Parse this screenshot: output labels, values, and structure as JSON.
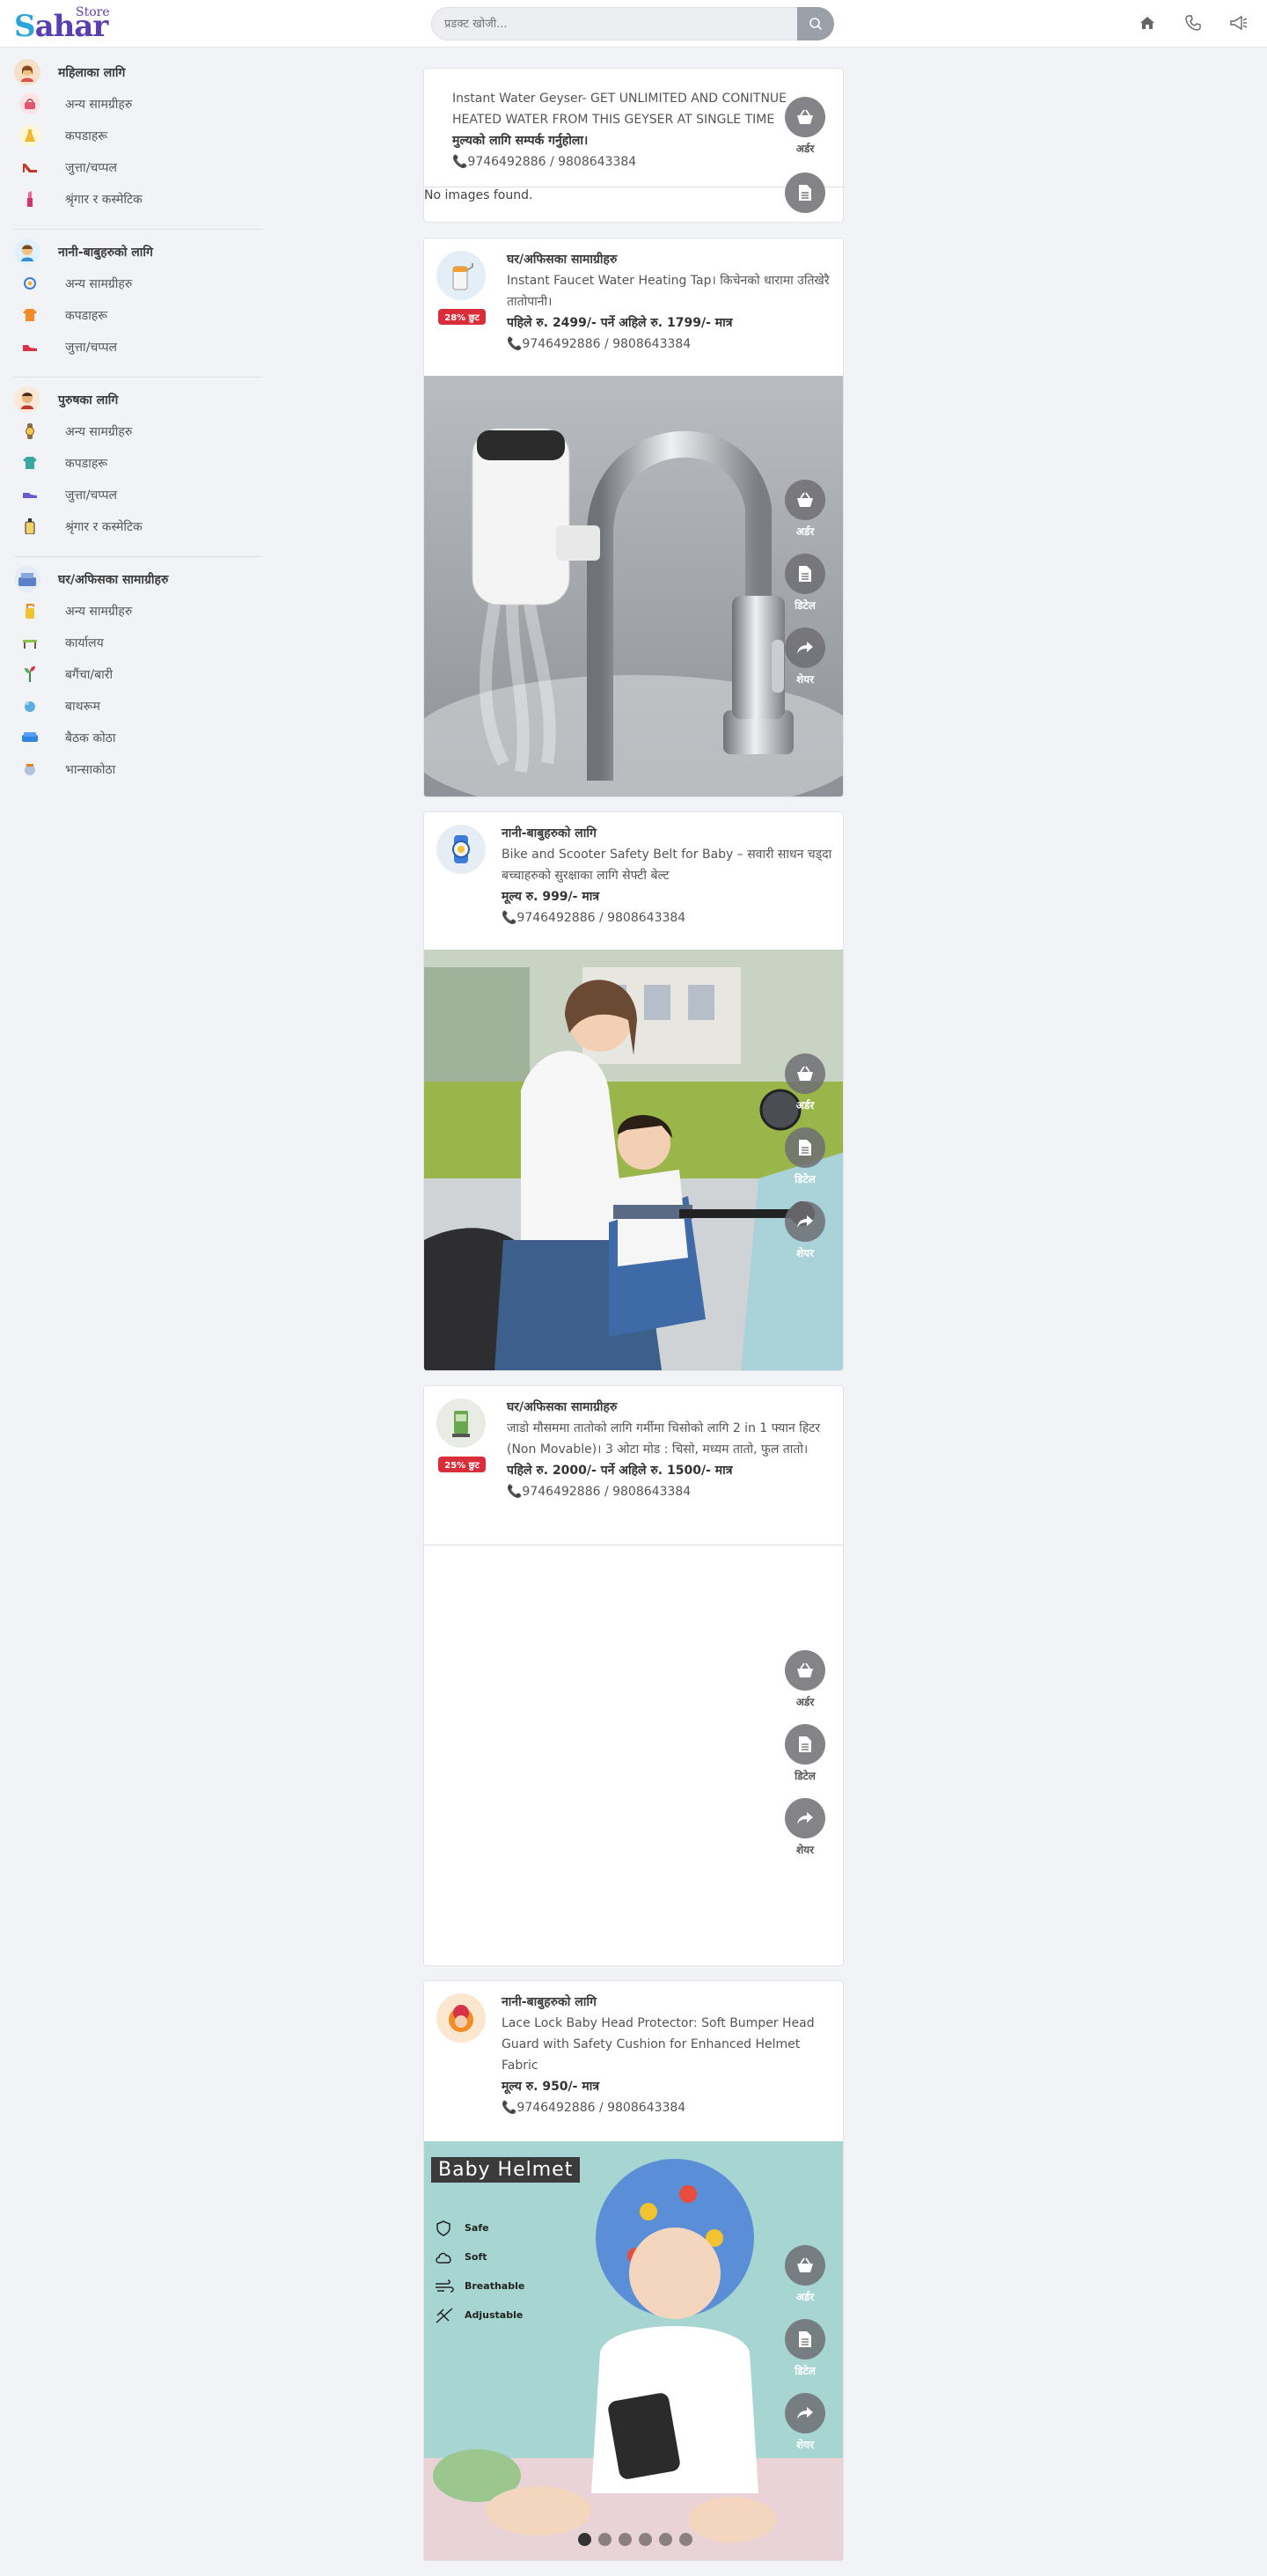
{
  "header": {
    "logo_main": "Sahar",
    "logo_small": "Store",
    "search_placeholder": "प्रडक्ट खोजी..."
  },
  "sidebar": [
    {
      "title": "महिलाका लागि",
      "items": [
        "अन्य सामग्रीहरु",
        "कपडाहरू",
        "जुत्ता/चप्पल",
        "श्रृंगार र कस्मेटिक"
      ]
    },
    {
      "title": "नानी-बाबुहरुको लागि",
      "items": [
        "अन्य सामग्रीहरु",
        "कपडाहरू",
        "जुत्ता/चप्पल"
      ]
    },
    {
      "title": "पुरुषका लागि",
      "items": [
        "अन्य सामग्रीहरु",
        "कपडाहरू",
        "जुत्ता/चप्पल",
        "श्रृंगार र कस्मेटिक"
      ]
    },
    {
      "title": "घर/अफिसका सामाग्रीहरु",
      "items": [
        "अन्य सामग्रीहरु",
        "कार्यालय",
        "बगैंचा/बारी",
        "बाथरूम",
        "बैठक कोठा",
        "भान्साकोठा"
      ]
    }
  ],
  "actions": {
    "order": "अर्डर",
    "detail": "डिटेल",
    "share": "शेयर"
  },
  "posts": [
    {
      "description": "Instant Water Geyser- GET UNLIMITED AND CONITNUE HEATED WATER FROM THIS GEYSER AT SINGLE TIME",
      "price_line": "मुल्यको लागि सम्पर्क गर्नुहोला।",
      "phone": "📞9746492886 / 9808643384",
      "no_images": "No images found."
    },
    {
      "category": "घर/अफिसका सामाग्रीहरु",
      "discount": "28% छुट",
      "description": "Instant Faucet Water Heating Tap। किचेनको धारामा उतिखेरै तातोपानी।",
      "price_line": "पहिले रु. 2499/- पर्ने अहिले रु. 1799/- मात्र",
      "phone": "📞9746492886 / 9808643384"
    },
    {
      "category": "नानी-बाबुहरुको लागि",
      "description": "Bike and Scooter Safety Belt for Baby – सवारी साधन चड्दा बच्चाहरुको सुरक्षाका लागि सेफ्टी बेल्ट",
      "price_line": "मूल्य रु. 999/- मात्र",
      "phone": "📞9746492886 / 9808643384"
    },
    {
      "category": "घर/अफिसका सामाग्रीहरु",
      "discount": "25% छुट",
      "description": "जाडो मौसममा तातोको लागि गर्मीमा चिसोको लागि 2 in 1 फ्यान हिटर (Non Movable)। 3 ओटा मोड : चिसो, मध्यम तातो, फुल तातो।",
      "price_line": "पहिले रु. 2000/- पर्ने अहिले रु. 1500/- मात्र",
      "phone": "📞9746492886 / 9808643384"
    },
    {
      "category": "नानी-बाबुहरुको लागि",
      "description": "Lace Lock Baby Head Protector: Soft Bumper Head Guard with Safety Cushion for Enhanced Helmet Fabric",
      "price_line": "मूल्य रु. 950/- मात्र",
      "phone": "📞9746492886 / 9808643384",
      "banner_title": "Baby Helmet",
      "features": [
        "Safe",
        "Soft",
        "Breathable",
        "Adjustable"
      ]
    }
  ],
  "colors": {
    "accent": "#d92d3a",
    "fab": "#6e6e73",
    "background": "#f2f3f7"
  }
}
